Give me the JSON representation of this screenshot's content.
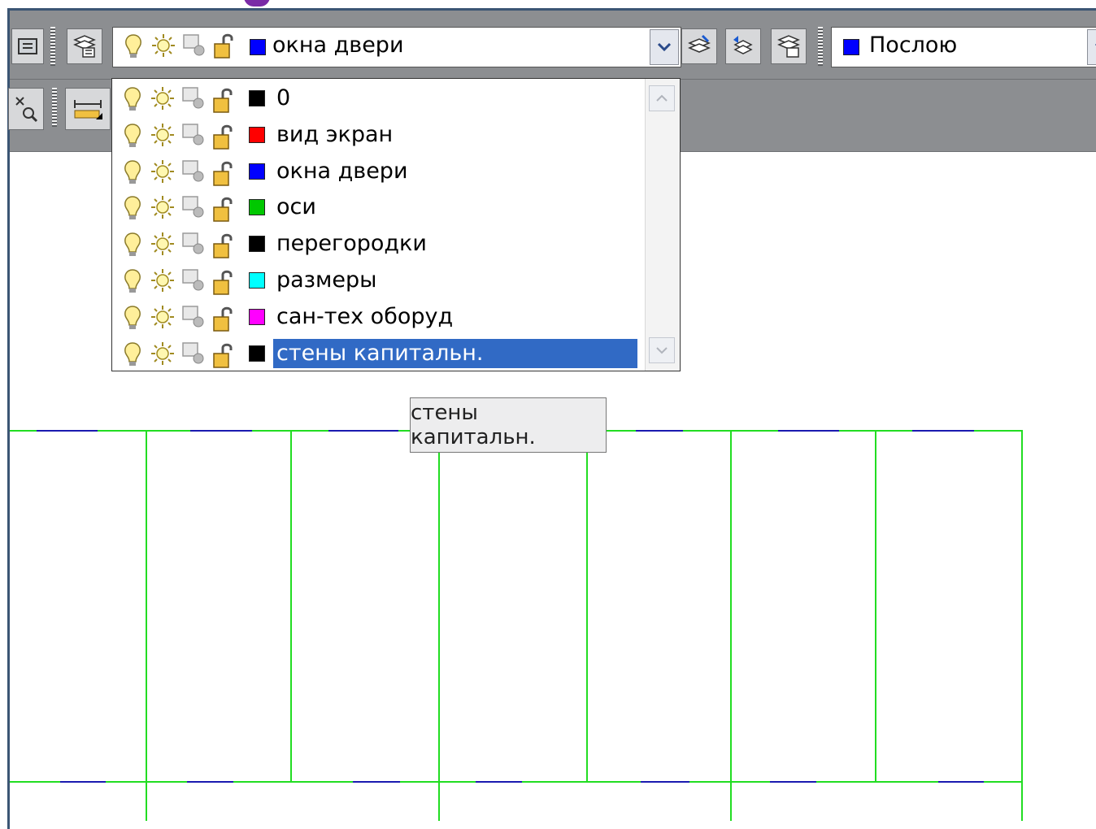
{
  "current_layer": {
    "name": "окна двери",
    "color": "#0000ff"
  },
  "layer_list": [
    {
      "name": "0",
      "color": "#000000"
    },
    {
      "name": "вид экран",
      "color": "#ff0000"
    },
    {
      "name": "окна двери",
      "color": "#0000ff"
    },
    {
      "name": "оси",
      "color": "#00c800"
    },
    {
      "name": "перегородки",
      "color": "#000000"
    },
    {
      "name": "размеры",
      "color": "#00ffff"
    },
    {
      "name": "сан-тех оборуд",
      "color": "#ff00ff"
    },
    {
      "name": "стены капитальн.",
      "color": "#000000",
      "selected": true
    }
  ],
  "color_control": {
    "value": "Послою",
    "color": "#0000ff"
  },
  "tooltip": {
    "text": "стены капитальн."
  },
  "icons": {
    "layer_state_on": "bulb-icon",
    "layer_state_thaw": "sun-icon",
    "layer_state_viewport": "viewport-freeze-icon",
    "layer_state_lock": "unlock-icon"
  },
  "colors": {
    "grid_line": "#22dd22",
    "dash_line": "#1a1ab0",
    "selection": "#316ac5"
  }
}
